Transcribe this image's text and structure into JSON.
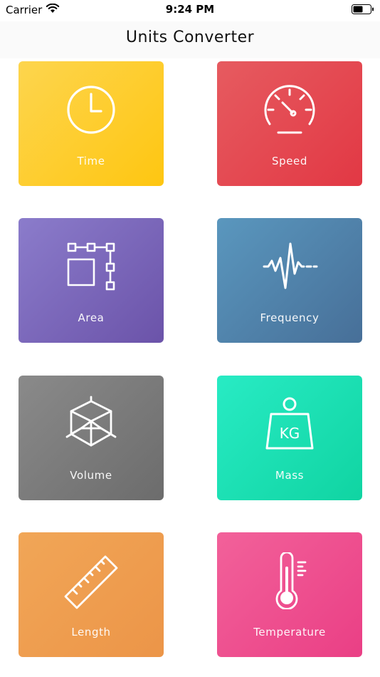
{
  "status_bar": {
    "carrier": "Carrier",
    "time": "9:24 PM",
    "wifi_icon": "wifi-icon",
    "battery_icon": "battery-icon"
  },
  "nav": {
    "title": "Units Converter"
  },
  "categories": [
    {
      "label": "Time",
      "icon": "clock-icon",
      "color": "#fec611"
    },
    {
      "label": "Speed",
      "icon": "speedometer-icon",
      "color": "#e23844"
    },
    {
      "label": "Area",
      "icon": "area-selection-icon",
      "color": "#6b53a9"
    },
    {
      "label": "Frequency",
      "icon": "waveform-icon",
      "color": "#476f98"
    },
    {
      "label": "Volume",
      "icon": "cube-icon",
      "color": "#6c6c6c"
    },
    {
      "label": "Mass",
      "icon": "weight-kg-icon",
      "color": "#10d4a2"
    },
    {
      "label": "Length",
      "icon": "ruler-icon",
      "color": "#ec9548"
    },
    {
      "label": "Temperature",
      "icon": "thermometer-icon",
      "color": "#ea3f85"
    }
  ],
  "mass_icon_text": "KG"
}
